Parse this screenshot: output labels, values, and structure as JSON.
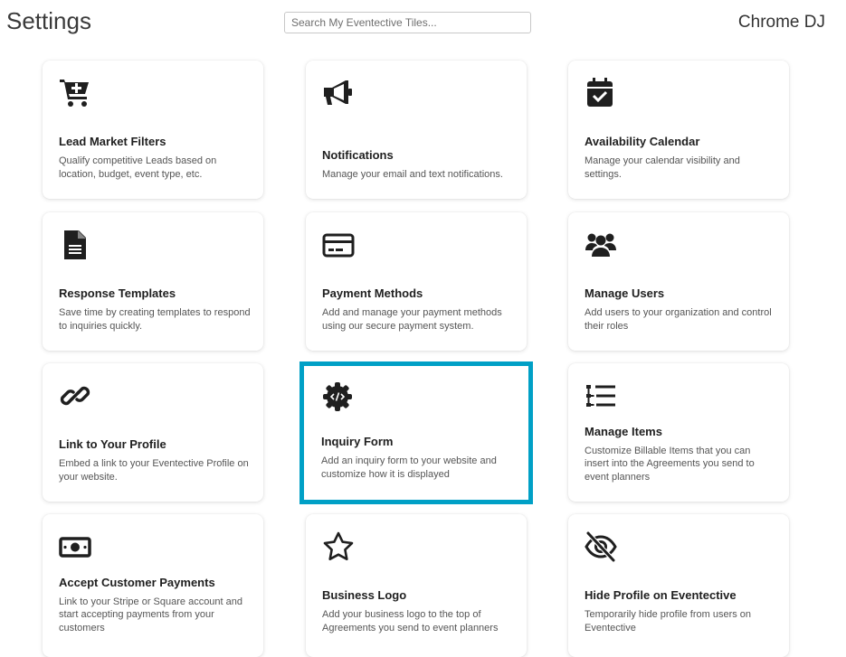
{
  "header": {
    "title": "Settings",
    "search_placeholder": "Search My Eventective Tiles...",
    "account_name": "Chrome DJ"
  },
  "tiles": [
    {
      "title": "Lead Market Filters",
      "desc": "Qualify competitive Leads based on location, budget, event type, etc.",
      "icon": "cart-plus-icon"
    },
    {
      "title": "Notifications",
      "desc": "Manage your email and text notifications.",
      "icon": "megaphone-icon"
    },
    {
      "title": "Availability Calendar",
      "desc": "Manage your calendar visibility and settings.",
      "icon": "calendar-check-icon"
    },
    {
      "title": "Response Templates",
      "desc": "Save time by creating templates to respond to inquiries quickly.",
      "icon": "document-icon"
    },
    {
      "title": "Payment Methods",
      "desc": "Add and manage your payment methods using our secure payment system.",
      "icon": "credit-card-icon"
    },
    {
      "title": "Manage Users",
      "desc": "Add users to your organization and control their roles",
      "icon": "users-icon"
    },
    {
      "title": "Link to Your Profile",
      "desc": "Embed a link to your Eventective Profile on your website.",
      "icon": "link-icon"
    },
    {
      "title": "Inquiry Form",
      "desc": "Add an inquiry form to your website and customize how it is displayed",
      "icon": "code-gear-icon"
    },
    {
      "title": "Manage Items",
      "desc": "Customize Billable Items that you can insert into the Agreements you send to event planners",
      "icon": "list-tree-icon"
    },
    {
      "title": "Accept Customer Payments",
      "desc": "Link to your Stripe or Square account and start accepting payments from your customers",
      "icon": "money-bill-icon"
    },
    {
      "title": "Business Logo",
      "desc": "Add your business logo to the top of Agreements you send to event planners",
      "icon": "star-icon"
    },
    {
      "title": "Hide Profile on Eventective",
      "desc": "Temporarily hide profile from users on Eventective",
      "icon": "eye-slash-icon"
    }
  ],
  "selected_tile": "Inquiry Form",
  "colors": {
    "selected_border": "#00a0c6",
    "icon": "#1f1f1f"
  }
}
